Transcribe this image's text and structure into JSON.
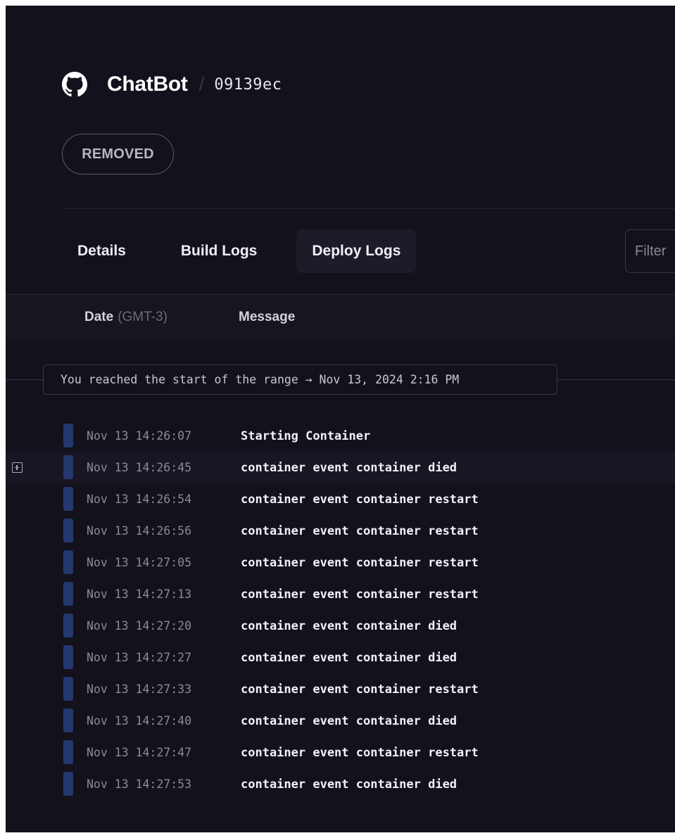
{
  "header": {
    "project_name": "ChatBot",
    "separator": "/",
    "commit": "09139ec",
    "icon": "github-icon"
  },
  "status_badge": "REMOVED",
  "tabs": [
    {
      "label": "Details",
      "active": false
    },
    {
      "label": "Build Logs",
      "active": false
    },
    {
      "label": "Deploy Logs",
      "active": true
    }
  ],
  "filter": {
    "placeholder": "Filter"
  },
  "columns": {
    "date_label": "Date",
    "timezone": "(GMT-3)",
    "message_label": "Message"
  },
  "range_notice": "You reached the start of the range → Nov 13, 2024 2:16 PM",
  "logs": [
    {
      "time": "Nov 13 14:26:07",
      "message": "Starting Container"
    },
    {
      "time": "Nov 13 14:26:45",
      "message": "container event container died"
    },
    {
      "time": "Nov 13 14:26:54",
      "message": "container event container restart"
    },
    {
      "time": "Nov 13 14:26:56",
      "message": "container event container restart"
    },
    {
      "time": "Nov 13 14:27:05",
      "message": "container event container restart"
    },
    {
      "time": "Nov 13 14:27:13",
      "message": "container event container restart"
    },
    {
      "time": "Nov 13 14:27:20",
      "message": "container event container died"
    },
    {
      "time": "Nov 13 14:27:27",
      "message": "container event container died"
    },
    {
      "time": "Nov 13 14:27:33",
      "message": "container event container restart"
    },
    {
      "time": "Nov 13 14:27:40",
      "message": "container event container died"
    },
    {
      "time": "Nov 13 14:27:47",
      "message": "container event container restart"
    },
    {
      "time": "Nov 13 14:27:53",
      "message": "container event container died"
    }
  ],
  "colors": {
    "background": "#13111c",
    "level_bar": "#24386d",
    "text": "#f2f0f8",
    "muted": "#8c8a98"
  }
}
